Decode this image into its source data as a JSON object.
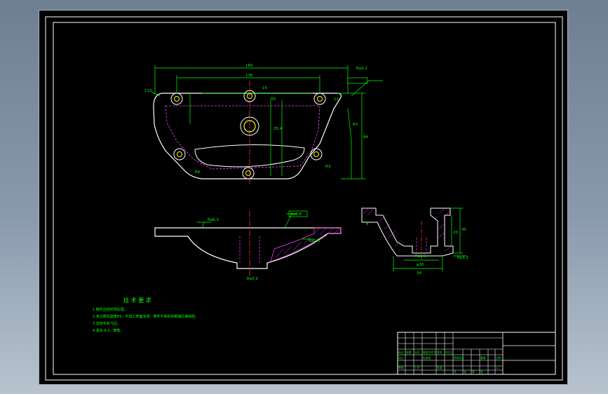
{
  "drawing": {
    "dims_top": [
      "160",
      "136",
      "15",
      "R5",
      "110",
      "Ra3.2",
      "R6",
      "R3",
      "25.4",
      "84",
      "60",
      "12"
    ],
    "dims_side": [
      "Ra6.3",
      "Ra0.8",
      "Ra1.6",
      "Ra3.2"
    ],
    "dims_section": [
      "4",
      "45",
      "20",
      "Ra1.6",
      "Ra3.2",
      "φ30",
      "34"
    ],
    "tech": {
      "title": "技 术 要 求",
      "lines": [
        "1.铸件应经时效处理。",
        "2.未注铸造圆角R3，不加工表面涂漆，铸件不得有砂眼缩孔等缺陷。",
        "3.去除毛刺飞边。",
        "4.其余 6.3，倒角。"
      ]
    },
    "title_block": {
      "cells": [
        "标记",
        "处数",
        "分区",
        "更改文件号",
        "签名",
        "年月日",
        "设计",
        "标准化",
        "阶段标记",
        "重量",
        "比例",
        "审核",
        "工艺",
        "批准",
        "共",
        "张",
        "第",
        "张",
        "1:1"
      ]
    }
  }
}
